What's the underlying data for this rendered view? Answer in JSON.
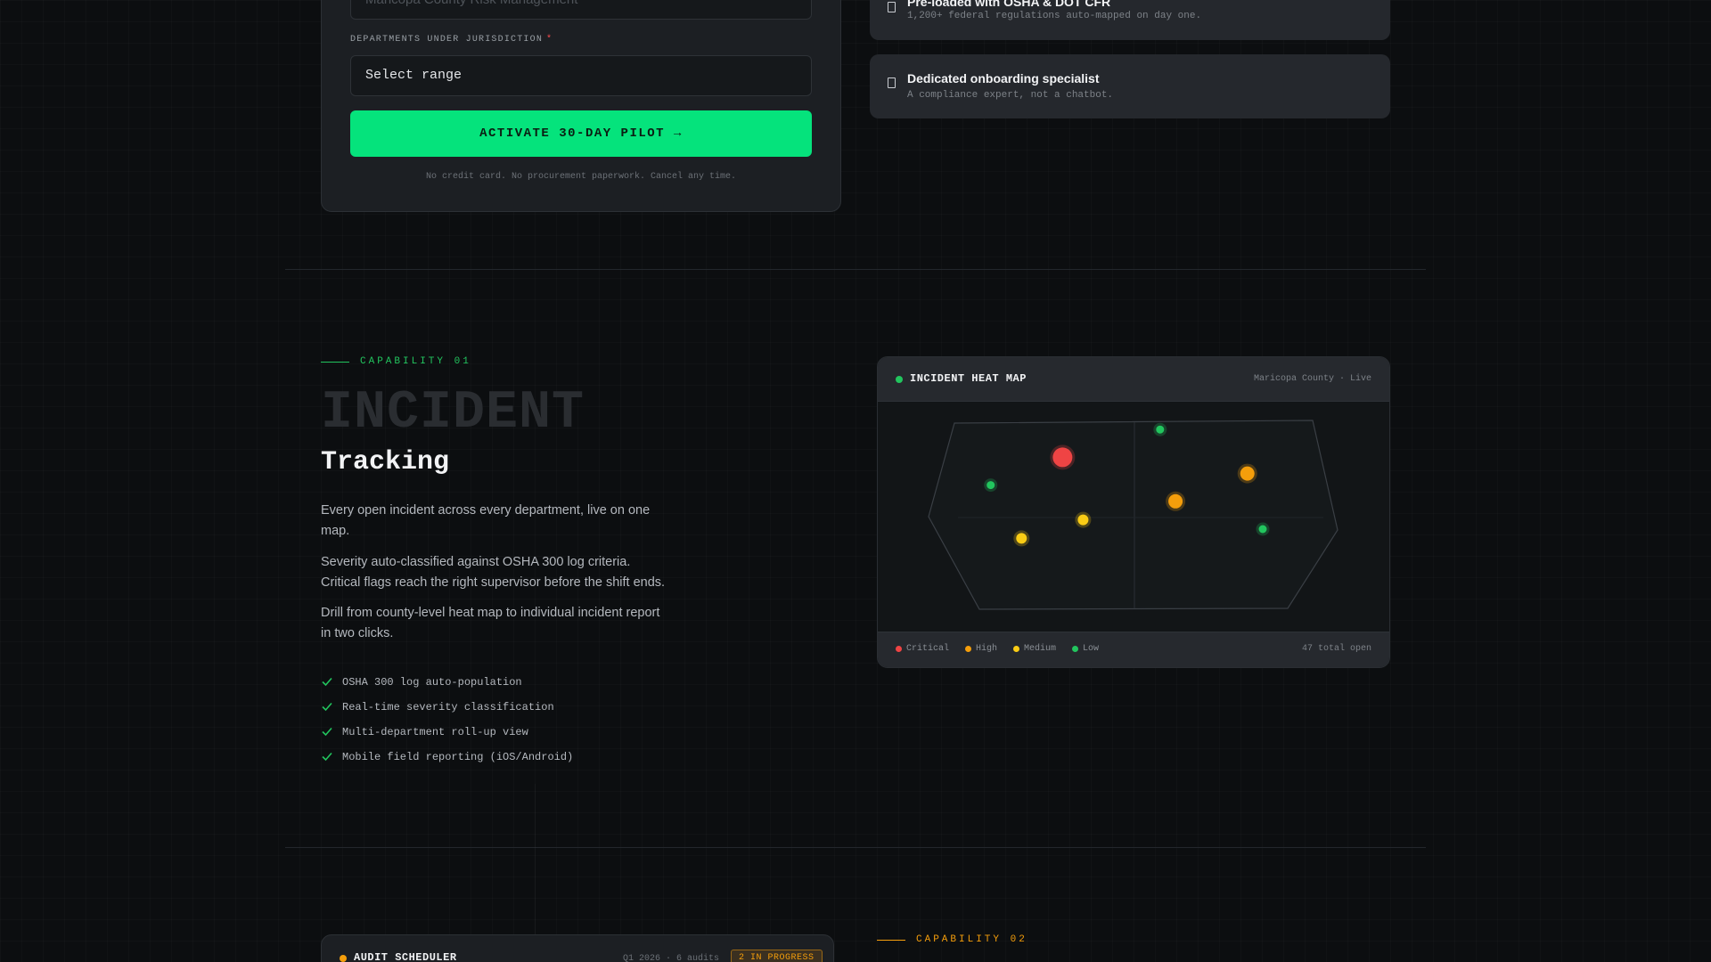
{
  "signup_form": {
    "org_field_placeholder": "Maricopa County Risk Management",
    "departments_label": "DEPARTMENTS UNDER JURISDICTION",
    "required_marker": "*",
    "departments_value": "Select range",
    "cta_label": "ACTIVATE 30-DAY PILOT →",
    "fine_print": "No credit card. No procurement paperwork. Cancel any time."
  },
  "features": [
    {
      "title": "Pre-loaded with OSHA & DOT CFR",
      "subtitle": "1,200+ federal regulations auto-mapped on day one.",
      "icon": "document-icon"
    },
    {
      "title": "Dedicated onboarding specialist",
      "subtitle": "A compliance expert, not a chatbot.",
      "icon": "document-icon"
    }
  ],
  "capability_01": {
    "eyebrow": "CAPABILITY 01",
    "ghost_title": "INCIDENT",
    "title": "Tracking",
    "paragraphs": [
      "Every open incident across every department, live on one map.",
      "Severity auto-classified against OSHA 300 log criteria. Critical flags reach the right supervisor before the shift ends.",
      "Drill from county-level heat map to individual incident report in two clicks."
    ],
    "checklist": [
      "OSHA 300 log auto-population",
      "Real-time severity classification",
      "Multi-department roll-up view",
      "Mobile field reporting (iOS/Android)"
    ]
  },
  "heat_map": {
    "title": "INCIDENT HEAT MAP",
    "meta": "Maricopa County · Live",
    "legend": [
      {
        "label": "Critical",
        "color": "#ef4444"
      },
      {
        "label": "High",
        "color": "#f59e0b"
      },
      {
        "label": "Medium",
        "color": "#facc15"
      },
      {
        "label": "Low",
        "color": "#22c55e"
      }
    ],
    "total": "47 total open",
    "incidents": [
      {
        "severity": "critical",
        "fx": 0.36,
        "fy": 0.24
      },
      {
        "severity": "low",
        "fx": 0.55,
        "fy": 0.12
      },
      {
        "severity": "high",
        "fx": 0.72,
        "fy": 0.31
      },
      {
        "severity": "high",
        "fx": 0.58,
        "fy": 0.43
      },
      {
        "severity": "low",
        "fx": 0.22,
        "fy": 0.36
      },
      {
        "severity": "medium",
        "fx": 0.4,
        "fy": 0.51
      },
      {
        "severity": "medium",
        "fx": 0.28,
        "fy": 0.59
      },
      {
        "severity": "low",
        "fx": 0.75,
        "fy": 0.55
      }
    ]
  },
  "audit_scheduler": {
    "title": "AUDIT SCHEDULER",
    "meta": "Q1 2026 · 6 audits",
    "badge": "2 IN PROGRESS"
  },
  "capability_02": {
    "eyebrow": "CAPABILITY 02"
  },
  "colors": {
    "accent_green": "#05e37c",
    "accent_amber": "#f59e0b",
    "critical": "#ef4444",
    "background": "#0c0e10"
  }
}
